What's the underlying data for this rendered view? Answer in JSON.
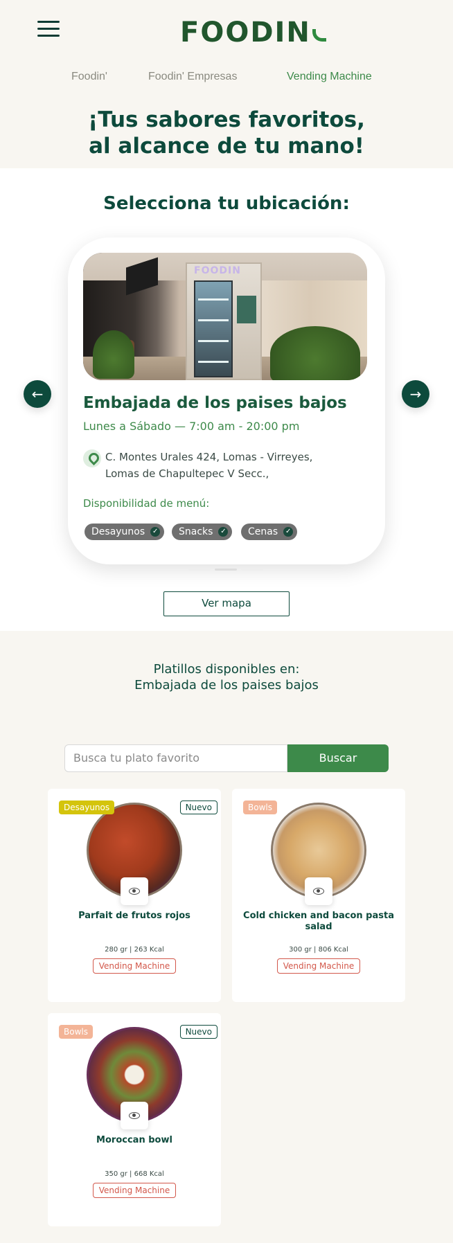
{
  "header": {
    "logo_text": "FOODIN",
    "nav": [
      "Foodin'",
      "Foodin' Empresas",
      "Vending Machine"
    ],
    "active_nav": "Vending Machine",
    "hero_line1": "¡Tus sabores favoritos,",
    "hero_line2": "al alcance de tu mano!"
  },
  "locations": {
    "title": "Selecciona tu ubicación:",
    "card": {
      "name": "Embajada de los paises bajos",
      "hours": "Lunes a Sábado — 7:00 am - 20:00 pm",
      "address_line1": "C. Montes Urales 424, Lomas - Virreyes,",
      "address_line2": "Lomas de Chapultepec V Secc.,",
      "menu_label": "Disponibilidad de menú:",
      "tags": [
        "Desayunos",
        "Snacks",
        "Cenas"
      ],
      "image_text": "FOODIN"
    },
    "map_button": "Ver mapa"
  },
  "dishes": {
    "title_line1": "Platillos disponibles en:",
    "title_line2": "Embajada de los paises bajos",
    "search_placeholder": "Busca tu plato favorito",
    "search_button": "Buscar",
    "items": [
      {
        "category": "Desayunos",
        "category_color": "#d4c40c",
        "badge": "Nuevo",
        "name": "Parfait de frutos rojos",
        "info": "280 gr | 263 Kcal",
        "location": "Vending Machine"
      },
      {
        "category": "Bowls",
        "category_color": "#f3b497",
        "badge": "",
        "name": "Cold chicken and bacon pasta salad",
        "info": "300 gr | 806 Kcal",
        "location": "Vending Machine"
      },
      {
        "category": "Bowls",
        "category_color": "#f3b497",
        "badge": "Nuevo",
        "name": "Moroccan bowl",
        "info": "350 gr | 668 Kcal",
        "location": "Vending Machine"
      }
    ]
  },
  "colors": {
    "primary": "#0d4a3c",
    "green": "#3d8a4a",
    "background": "#f8f6f1",
    "location_tag": "#d2574a"
  }
}
